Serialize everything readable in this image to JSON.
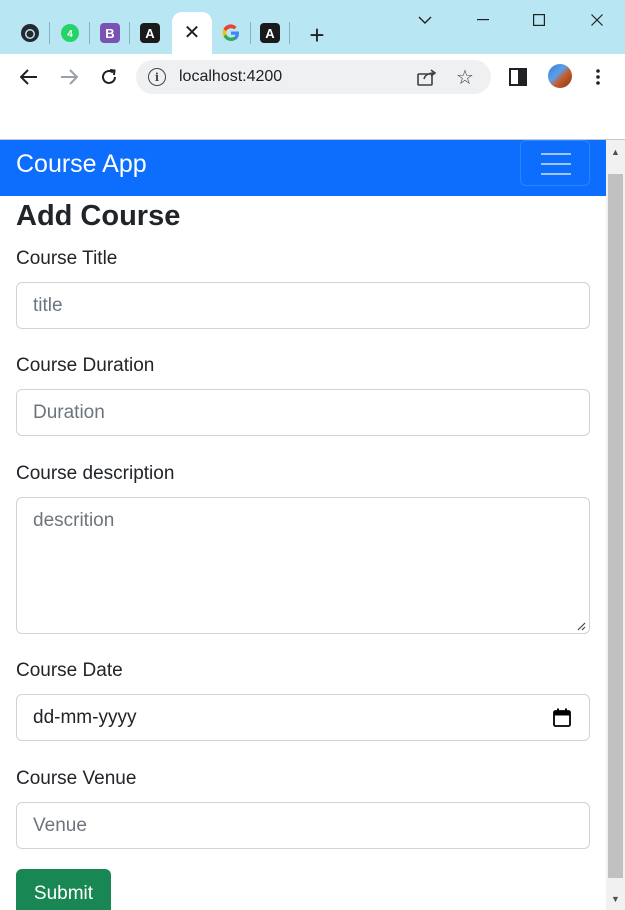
{
  "browser": {
    "tabs": [
      {
        "icon": "github-icon",
        "glyph": "",
        "color": "#24292f"
      },
      {
        "icon": "whatsapp-icon",
        "glyph": "",
        "color": "#25d366"
      },
      {
        "icon": "bootstrap-icon",
        "glyph": "B",
        "color": "#7952b3"
      },
      {
        "icon": "angular-icon",
        "glyph": "A",
        "color": "#1a1a1a"
      },
      {
        "icon": "close-icon",
        "glyph": "✕",
        "color": "#202124",
        "active": true
      },
      {
        "icon": "google-icon",
        "glyph": "G",
        "color": "#4285f4"
      },
      {
        "icon": "angular-icon",
        "glyph": "A",
        "color": "#1a1a1a"
      }
    ],
    "new_tab_glyph": "+",
    "url": "localhost:4200",
    "info_glyph": "i",
    "star_glyph": "☆"
  },
  "app": {
    "brand": "Course App",
    "navbar_color": "#0d6efd"
  },
  "form": {
    "heading": "Add Course",
    "title_label": "Course Title",
    "title_placeholder": "title",
    "duration_label": "Course Duration",
    "duration_placeholder": "Duration",
    "description_label": "Course description",
    "description_placeholder": "descrition",
    "date_label": "Course Date",
    "date_value": "dd-mm-yyyy",
    "venue_label": "Course Venue",
    "venue_placeholder": "Venue",
    "submit_label": "Submit",
    "submit_color": "#198754"
  },
  "scrollbar": {
    "up_glyph": "▲",
    "down_glyph": "▼"
  }
}
